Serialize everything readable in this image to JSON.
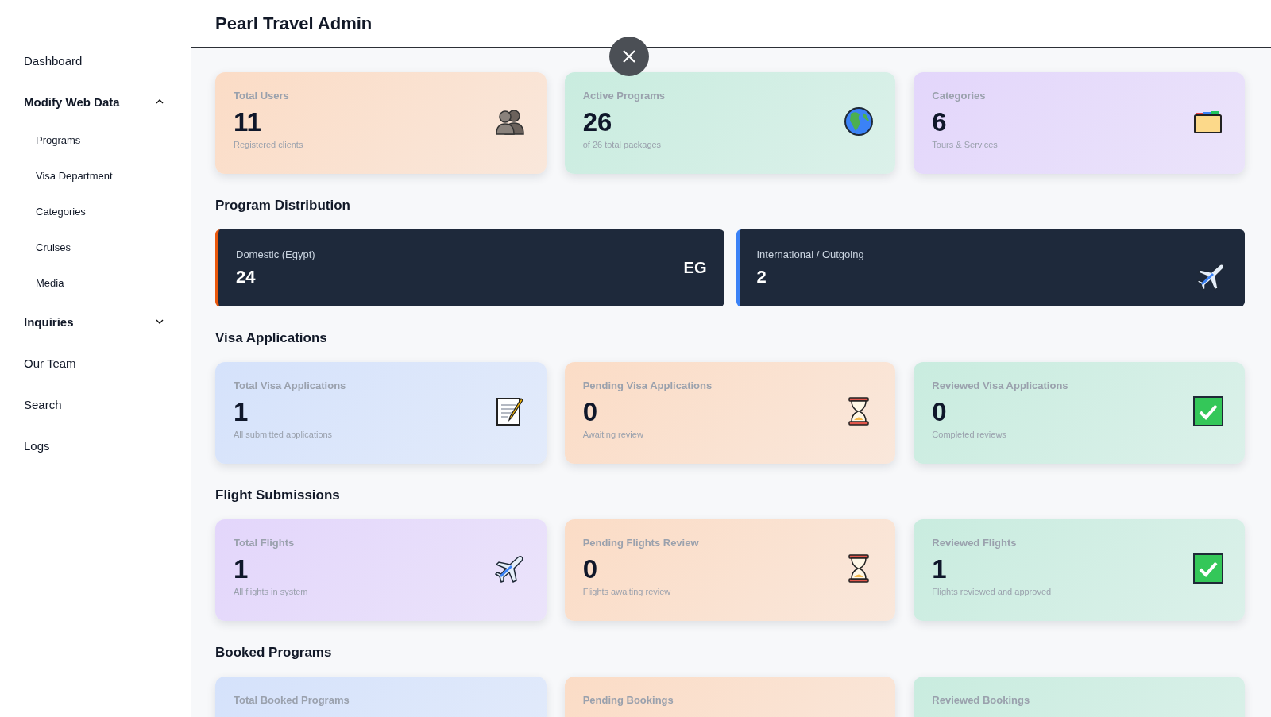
{
  "sidebar": {
    "items": [
      {
        "label": "Dashboard",
        "kind": "link"
      },
      {
        "label": "Modify Web Data",
        "kind": "group",
        "expanded": true,
        "children": [
          {
            "label": "Programs"
          },
          {
            "label": "Visa Department"
          },
          {
            "label": "Categories"
          },
          {
            "label": "Cruises"
          },
          {
            "label": "Media"
          }
        ]
      },
      {
        "label": "Inquiries",
        "kind": "group",
        "expanded": false
      },
      {
        "label": "Our Team",
        "kind": "link"
      },
      {
        "label": "Search",
        "kind": "link"
      },
      {
        "label": "Logs",
        "kind": "link"
      }
    ]
  },
  "header": {
    "title": "Pearl Travel Admin"
  },
  "overview": [
    {
      "label": "Total Users",
      "value": "11",
      "caption": "Registered clients",
      "color": "#fbdcc6"
    },
    {
      "label": "Active Programs",
      "value": "26",
      "caption": "of 26 total packages",
      "color": "#c9ecdf"
    },
    {
      "label": "Categories",
      "value": "6",
      "caption": "Tours & Services",
      "color": "#e3d6fb"
    }
  ],
  "distribution": {
    "title": "Program Distribution",
    "items": [
      {
        "label": "Domestic (Egypt)",
        "value": "24",
        "badge": "EG",
        "color": "#ea580c"
      },
      {
        "label": "International / Outgoing",
        "value": "2",
        "color": "#3b82f6"
      }
    ]
  },
  "sections": [
    {
      "title": "Visa Applications",
      "cards": [
        {
          "label": "Total Visa Applications",
          "value": "1",
          "caption": "All submitted applications",
          "color": "#d5e2fb"
        },
        {
          "label": "Pending Visa Applications",
          "value": "0",
          "caption": "Awaiting review",
          "color": "#fbdcc6"
        },
        {
          "label": "Reviewed Visa Applications",
          "value": "0",
          "caption": "Completed reviews",
          "color": "#c9ecdf"
        }
      ]
    },
    {
      "title": "Flight Submissions",
      "cards": [
        {
          "label": "Total Flights",
          "value": "1",
          "caption": "All flights in system",
          "color": "#e3d6fb"
        },
        {
          "label": "Pending Flights Review",
          "value": "0",
          "caption": "Flights awaiting review",
          "color": "#fbdcc6"
        },
        {
          "label": "Reviewed Flights",
          "value": "1",
          "caption": "Flights reviewed and approved",
          "color": "#c9ecdf"
        }
      ]
    },
    {
      "title": "Booked Programs",
      "cards": [
        {
          "label": "Total Booked Programs",
          "color": "#d5e2fb"
        },
        {
          "label": "Pending Bookings",
          "color": "#fbdcc6"
        },
        {
          "label": "Reviewed Bookings",
          "color": "#c9ecdf"
        }
      ]
    }
  ]
}
